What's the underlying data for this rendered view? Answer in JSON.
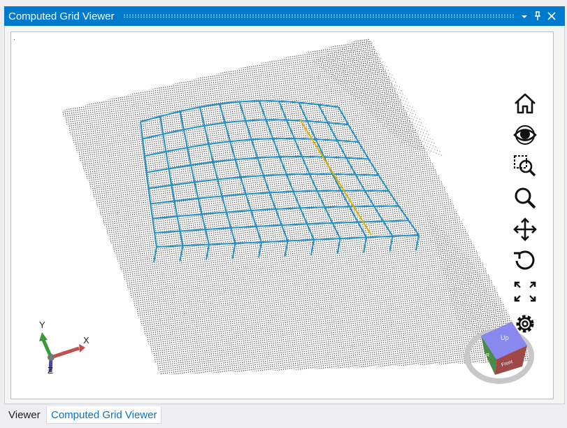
{
  "window": {
    "title": "Computed Grid Viewer",
    "dropdown_icon": "chevron-down-icon",
    "pin_icon": "pin-icon",
    "close_icon": "close-icon"
  },
  "viewport": {
    "axes": {
      "x_label": "X",
      "y_label": "Y",
      "z_label": "Z"
    },
    "view_cube": {
      "top_label": "Up",
      "front_label": "Front",
      "side_label": "R"
    },
    "toolbar": [
      {
        "name": "home-icon"
      },
      {
        "name": "eye-icon"
      },
      {
        "name": "zoom-window-icon"
      },
      {
        "name": "zoom-icon"
      },
      {
        "name": "pan-icon"
      },
      {
        "name": "rotate-icon"
      },
      {
        "name": "fit-extents-icon"
      },
      {
        "name": "settings-icon"
      }
    ],
    "colors": {
      "point_cloud": "#1a1a1a",
      "grid": "#1e90c8",
      "highlight_line": "#e0b000",
      "x_axis": "#c0504d",
      "y_axis": "#3a9a3a",
      "z_axis": "#4a4a9a"
    }
  },
  "tabs": [
    {
      "label": "Viewer",
      "active": false
    },
    {
      "label": "Computed Grid Viewer",
      "active": true
    }
  ]
}
